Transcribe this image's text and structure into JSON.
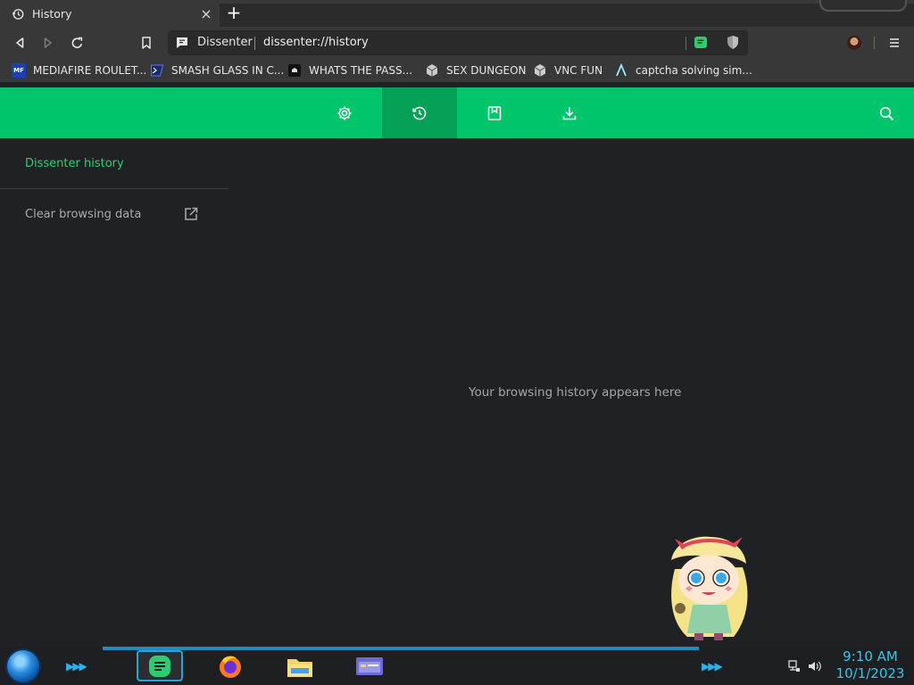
{
  "tab": {
    "title": "History",
    "close": "×",
    "new_tab": "+"
  },
  "omnibox": {
    "site_name": "Dissenter",
    "url": "dissenter://history"
  },
  "bookmarks": [
    {
      "label": "MEDIAFIRE ROULET...",
      "icon": "MF"
    },
    {
      "label": "SMASH GLASS IN C...",
      "icon": ""
    },
    {
      "label": "WHATS THE PASS...",
      "icon": ""
    },
    {
      "label": "SEX DUNGEON",
      "icon": ""
    },
    {
      "label": "VNC FUN",
      "icon": ""
    },
    {
      "label": "captcha solving sim...",
      "icon": ""
    }
  ],
  "sidebar": {
    "title": "Dissenter history",
    "clear": "Clear browsing data"
  },
  "main": {
    "empty_message": "Your browsing history appears here"
  },
  "taskbar": {
    "time": "9:10 AM",
    "date": "10/1/2023"
  },
  "colors": {
    "accent_green": "#01c56a",
    "active_green": "#03a056",
    "history_link": "#2ecc71",
    "clock_cyan": "#35c6e8"
  },
  "icons": {
    "header": [
      "settings-gear-icon",
      "history-clock-icon",
      "bookmark-icon",
      "download-icon",
      "search-icon"
    ],
    "toolbar": [
      "back-icon",
      "forward-icon",
      "reload-icon",
      "bookmark-icon",
      "dissenter-icon",
      "shield-icon",
      "menu-icon"
    ]
  }
}
